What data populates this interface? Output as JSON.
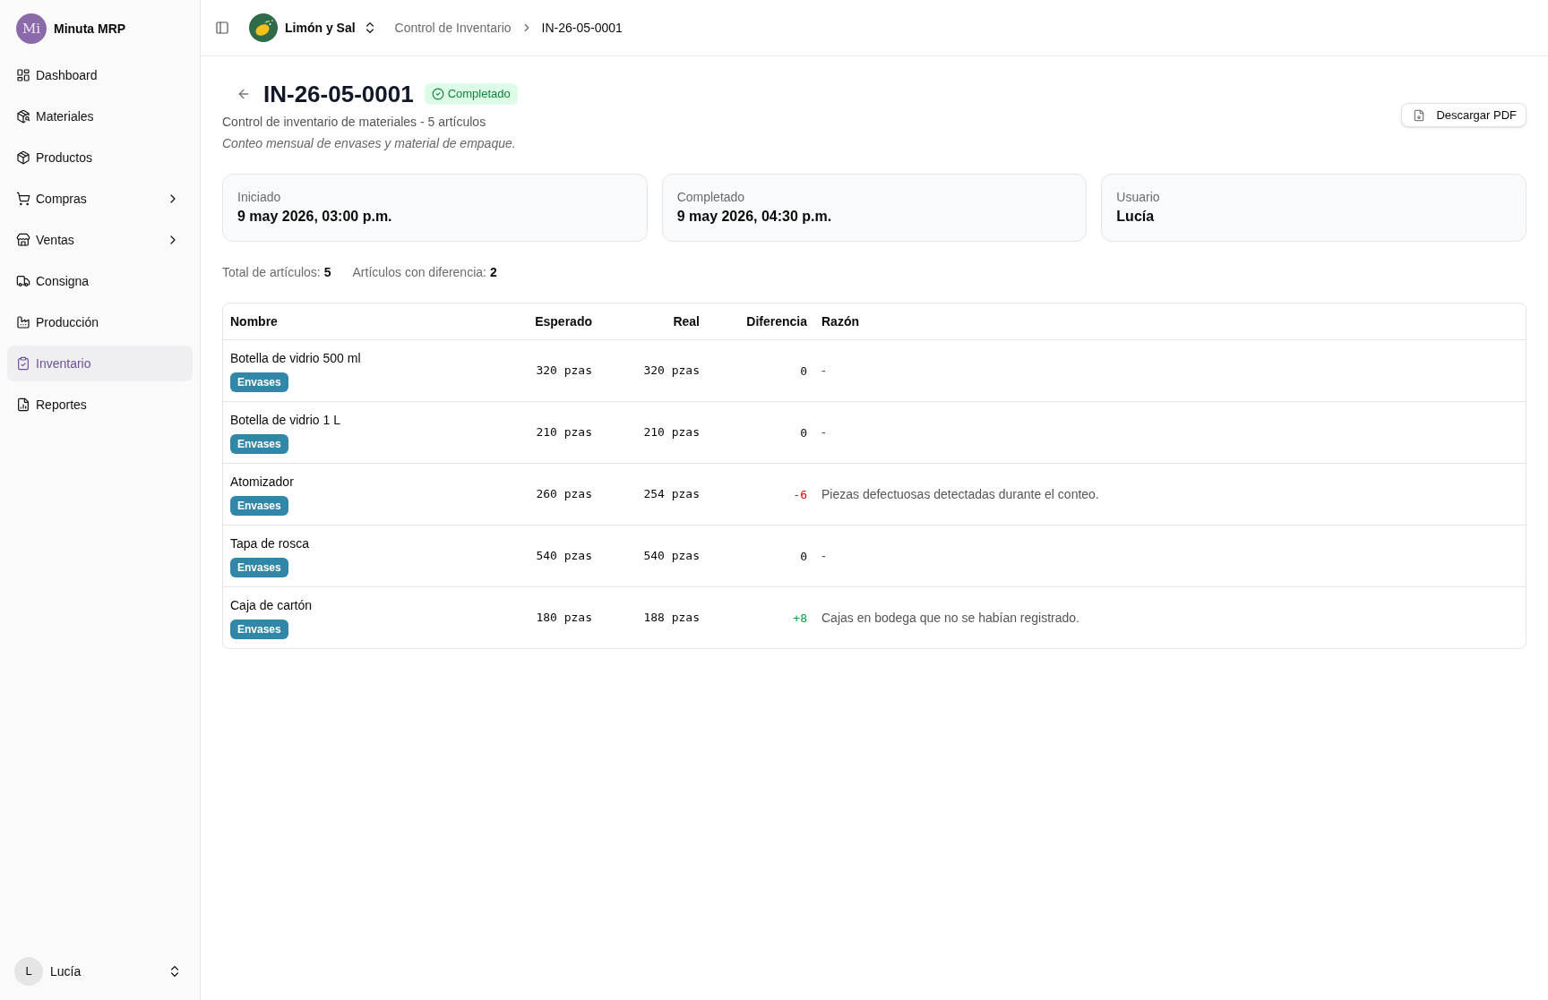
{
  "sidebar": {
    "brand": {
      "logo_text": "Mi",
      "name": "Minuta MRP"
    },
    "items": [
      {
        "label": "Dashboard",
        "kind": "link",
        "selected": false
      },
      {
        "label": "Materiales",
        "kind": "link",
        "selected": false
      },
      {
        "label": "Productos",
        "kind": "link",
        "selected": false
      },
      {
        "label": "Compras",
        "kind": "group",
        "selected": false
      },
      {
        "label": "Ventas",
        "kind": "group",
        "selected": false
      },
      {
        "label": "Consigna",
        "kind": "link",
        "selected": false
      },
      {
        "label": "Producción",
        "kind": "link",
        "selected": false
      },
      {
        "label": "Inventario",
        "kind": "link",
        "selected": true
      },
      {
        "label": "Reportes",
        "kind": "link",
        "selected": false
      }
    ],
    "user": {
      "initial": "L",
      "name": "Lucía"
    }
  },
  "header": {
    "company": "Limón y Sal",
    "breadcrumbs": [
      {
        "label": "Control de Inventario",
        "current": false
      },
      {
        "label": "IN-26-05-0001",
        "current": true
      }
    ]
  },
  "page": {
    "title": "IN-26-05-0001",
    "status": {
      "label": "Completado",
      "kind": "success"
    },
    "subtitle": "Control de inventario de materiales - 5 artículos",
    "note": "Conteo mensual de envases y material de empaque.",
    "download_button": "Descargar PDF"
  },
  "cards": [
    {
      "label": "Iniciado",
      "value": "9 may 2026, 03:00 p.m."
    },
    {
      "label": "Completado",
      "value": "9 may 2026, 04:30 p.m."
    },
    {
      "label": "Usuario",
      "value": "Lucía"
    }
  ],
  "totals": [
    {
      "label": "Total de artículos:",
      "value": "5"
    },
    {
      "label": "Artículos con diferencia:",
      "value": "2"
    }
  ],
  "table": {
    "columns": [
      "Nombre",
      "Esperado",
      "Real",
      "Diferencia",
      "Razón"
    ],
    "rows": [
      {
        "name": "Botella de vidrio 500 ml",
        "category": "Envases",
        "expected": "320 pzas",
        "actual": "320 pzas",
        "difference": "0",
        "color": "#0a0a0a",
        "reason": "-"
      },
      {
        "name": "Botella de vidrio 1 L",
        "category": "Envases",
        "expected": "210 pzas",
        "actual": "210 pzas",
        "difference": "0",
        "color": "#0a0a0a",
        "reason": "-"
      },
      {
        "name": "Atomizador",
        "category": "Envases",
        "expected": "260 pzas",
        "actual": "254 pzas",
        "difference": "-6",
        "color": "#e7000b",
        "reason": "Piezas defectuosas detectadas durante el conteo."
      },
      {
        "name": "Tapa de rosca",
        "category": "Envases",
        "expected": "540 pzas",
        "actual": "540 pzas",
        "difference": "0",
        "color": "#0a0a0a",
        "reason": "-"
      },
      {
        "name": "Caja de cartón",
        "category": "Envases",
        "expected": "180 pzas",
        "actual": "188 pzas",
        "difference": "+8",
        "color": "#00a63e",
        "reason": "Cajas en bodega que no se habían registrado."
      }
    ]
  }
}
